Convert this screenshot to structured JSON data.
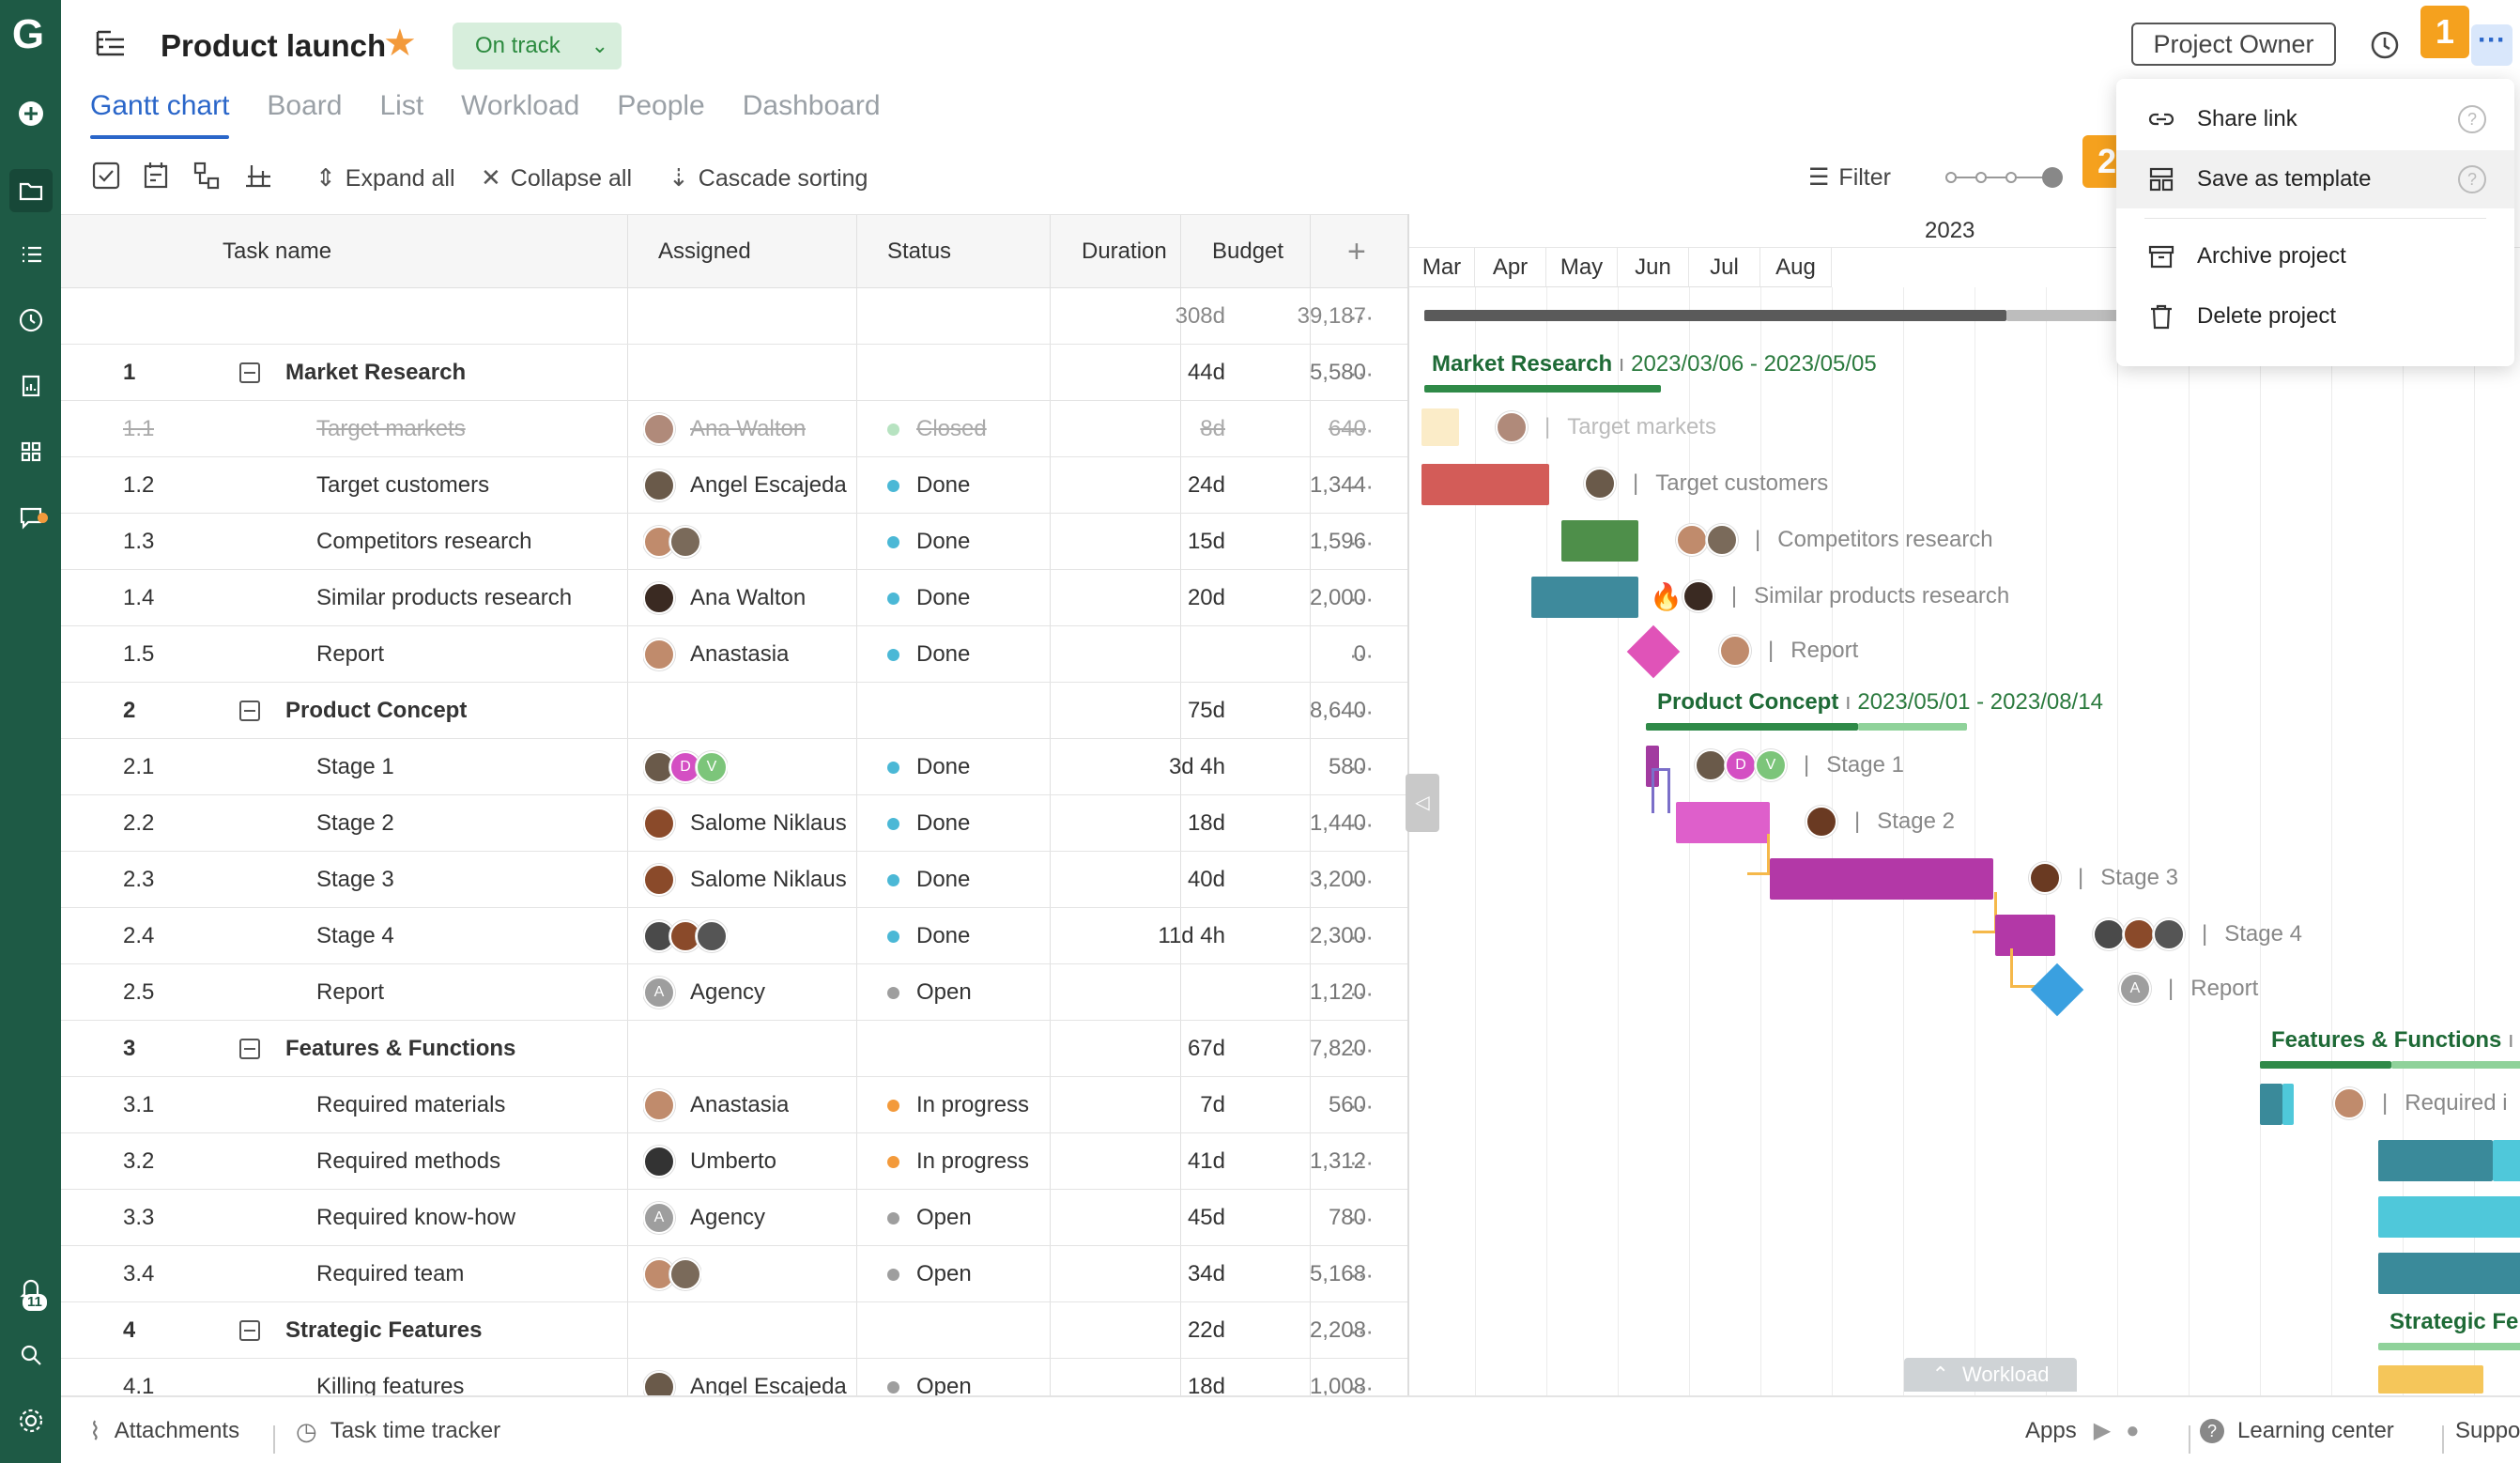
{
  "header": {
    "title": "Product launch",
    "status": "On track",
    "owner_button": "Project Owner"
  },
  "callouts": {
    "one": "1",
    "two": "2"
  },
  "tabs": [
    "Gantt chart",
    "Board",
    "List",
    "Workload",
    "People",
    "Dashboard"
  ],
  "toolbar": {
    "expand": "Expand all",
    "collapse": "Collapse all",
    "cascade": "Cascade sorting",
    "filter": "Filter"
  },
  "columns": {
    "task": "Task name",
    "assigned": "Assigned",
    "status": "Status",
    "duration": "Duration",
    "budget": "Budget"
  },
  "summary": {
    "duration": "308d",
    "budget": "39,187"
  },
  "rows": [
    {
      "num": "1",
      "name": "Market Research",
      "assign": "",
      "status": "",
      "dur": "44d",
      "bud": "5,580"
    },
    {
      "num": "1.1",
      "name": "Target markets",
      "assign": "Ana Walton",
      "status": "Closed",
      "dur": "8d",
      "bud": "640"
    },
    {
      "num": "1.2",
      "name": "Target customers",
      "assign": "Angel Escajeda",
      "status": "Done",
      "dur": "24d",
      "bud": "1,344"
    },
    {
      "num": "1.3",
      "name": "Competitors research",
      "assign": "",
      "status": "Done",
      "dur": "15d",
      "bud": "1,596"
    },
    {
      "num": "1.4",
      "name": "Similar products research",
      "assign": "Ana Walton",
      "status": "Done",
      "dur": "20d",
      "bud": "2,000"
    },
    {
      "num": "1.5",
      "name": "Report",
      "assign": "Anastasia",
      "status": "Done",
      "dur": "",
      "bud": "0"
    },
    {
      "num": "2",
      "name": "Product Concept",
      "assign": "",
      "status": "",
      "dur": "75d",
      "bud": "8,640"
    },
    {
      "num": "2.1",
      "name": "Stage 1",
      "assign": "",
      "status": "Done",
      "dur": "3d 4h",
      "bud": "580"
    },
    {
      "num": "2.2",
      "name": "Stage 2",
      "assign": "Salome Niklaus",
      "status": "Done",
      "dur": "18d",
      "bud": "1,440"
    },
    {
      "num": "2.3",
      "name": "Stage 3",
      "assign": "Salome Niklaus",
      "status": "Done",
      "dur": "40d",
      "bud": "3,200"
    },
    {
      "num": "2.4",
      "name": "Stage 4",
      "assign": "",
      "status": "Done",
      "dur": "11d 4h",
      "bud": "2,300"
    },
    {
      "num": "2.5",
      "name": "Report",
      "assign": "Agency",
      "status": "Open",
      "dur": "",
      "bud": "1,120"
    },
    {
      "num": "3",
      "name": "Features & Functions",
      "assign": "",
      "status": "",
      "dur": "67d",
      "bud": "7,820"
    },
    {
      "num": "3.1",
      "name": "Required materials",
      "assign": "Anastasia",
      "status": "In progress",
      "dur": "7d",
      "bud": "560"
    },
    {
      "num": "3.2",
      "name": "Required methods",
      "assign": "Umberto",
      "status": "In progress",
      "dur": "41d",
      "bud": "1,312"
    },
    {
      "num": "3.3",
      "name": "Required know-how",
      "assign": "Agency",
      "status": "Open",
      "dur": "45d",
      "bud": "780"
    },
    {
      "num": "3.4",
      "name": "Required team",
      "assign": "",
      "status": "Open",
      "dur": "34d",
      "bud": "5,168"
    },
    {
      "num": "4",
      "name": "Strategic Features",
      "assign": "",
      "status": "",
      "dur": "22d",
      "bud": "2,208"
    },
    {
      "num": "4.1",
      "name": "Killing features",
      "assign": "Angel Escajeda",
      "status": "Open",
      "dur": "18d",
      "bud": "1,008"
    }
  ],
  "gantt": {
    "year": "2023",
    "months": [
      "Mar",
      "Apr",
      "May",
      "Jun",
      "Jul",
      "Aug"
    ],
    "mr_title": "Market Research",
    "mr_dates": "2023/03/06 - 2023/05/05",
    "pc_title": "Product Concept",
    "pc_dates": "2023/05/01 - 2023/08/14",
    "ff_title": "Features & Functions",
    "sf_title": "Strategic Fe",
    "labels": {
      "target_markets": "Target markets",
      "target_customers": "Target customers",
      "competitors": "Competitors research",
      "similar": "Similar products research",
      "report": "Report",
      "stage1": "Stage 1",
      "stage2": "Stage 2",
      "stage3": "Stage 3",
      "stage4": "Stage 4",
      "report2": "Report",
      "required": "Required i"
    },
    "workload": "Workload",
    "avatar_letters": {
      "d": "D",
      "v": "V",
      "a": "A"
    }
  },
  "menu": {
    "share": "Share link",
    "template": "Save as template",
    "archive": "Archive project",
    "delete": "Delete project",
    "help": "?"
  },
  "footer": {
    "attachments": "Attachments",
    "tracker": "Task time tracker",
    "apps": "Apps",
    "learning": "Learning center",
    "support": "Support"
  },
  "rail": {
    "notif_count": "11"
  },
  "colors": {
    "brand": "#1e5a45",
    "accent": "#2a66c9",
    "callout": "#f5a11e",
    "done": "#4bb8d6",
    "progress": "#f39a3b",
    "open": "#9e9e9e",
    "closed": "#b7e3c1"
  }
}
